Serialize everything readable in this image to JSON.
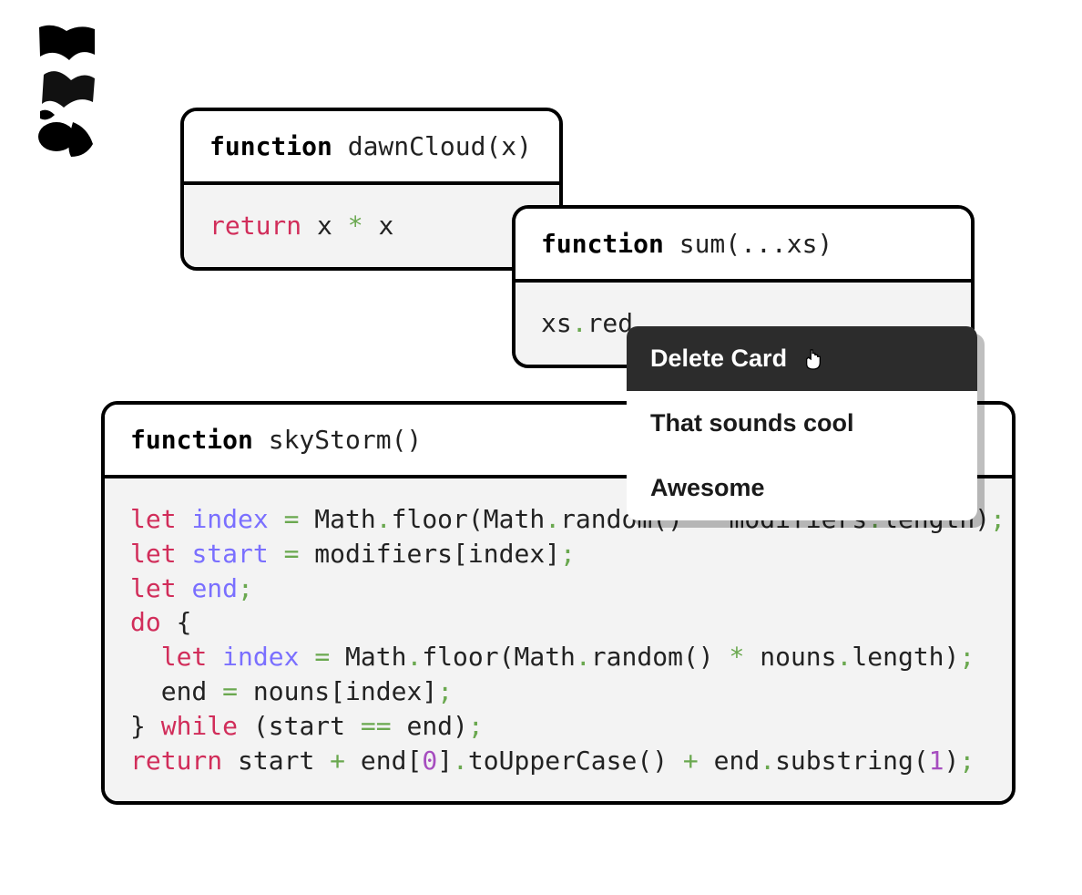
{
  "logo": {
    "kind": "abstract-bw-shape"
  },
  "cards": {
    "dawnCloud": {
      "header": {
        "keyword": "function",
        "rest": " dawnCloud(x)"
      },
      "body_tokens": [
        {
          "t": "return",
          "c": "kw-ret"
        },
        {
          "t": " x ",
          "c": "plain"
        },
        {
          "t": "*",
          "c": "punct"
        },
        {
          "t": " x",
          "c": "plain"
        }
      ]
    },
    "sum": {
      "header": {
        "keyword": "function",
        "rest": " sum(...xs)"
      },
      "body_tokens": [
        {
          "t": "xs",
          "c": "plain"
        },
        {
          "t": ".",
          "c": "punct"
        },
        {
          "t": "red",
          "c": "plain"
        }
      ]
    },
    "skyStorm": {
      "header": {
        "keyword": "function",
        "rest": " skyStorm()"
      },
      "body_lines": [
        [
          {
            "t": "let",
            "c": "kw-let"
          },
          {
            "t": " ",
            "c": "plain"
          },
          {
            "t": "index",
            "c": "ident"
          },
          {
            "t": " ",
            "c": "plain"
          },
          {
            "t": "=",
            "c": "punct"
          },
          {
            "t": " Math",
            "c": "plain"
          },
          {
            "t": ".",
            "c": "punct"
          },
          {
            "t": "floor",
            "c": "plain"
          },
          {
            "t": "(",
            "c": "plain"
          },
          {
            "t": "Math",
            "c": "plain"
          },
          {
            "t": ".",
            "c": "punct"
          },
          {
            "t": "random",
            "c": "plain"
          },
          {
            "t": "()",
            "c": "plain"
          },
          {
            "t": " ",
            "c": "plain"
          },
          {
            "t": "*",
            "c": "punct"
          },
          {
            "t": " modifiers",
            "c": "plain"
          },
          {
            "t": ".",
            "c": "punct"
          },
          {
            "t": "length",
            "c": "plain"
          },
          {
            "t": ")",
            "c": "plain"
          },
          {
            "t": ";",
            "c": "punct"
          }
        ],
        [
          {
            "t": "let",
            "c": "kw-let"
          },
          {
            "t": " ",
            "c": "plain"
          },
          {
            "t": "start",
            "c": "ident"
          },
          {
            "t": " ",
            "c": "plain"
          },
          {
            "t": "=",
            "c": "punct"
          },
          {
            "t": " modifiers",
            "c": "plain"
          },
          {
            "t": "[",
            "c": "plain"
          },
          {
            "t": "index",
            "c": "plain"
          },
          {
            "t": "]",
            "c": "plain"
          },
          {
            "t": ";",
            "c": "punct"
          }
        ],
        [
          {
            "t": "let",
            "c": "kw-let"
          },
          {
            "t": " ",
            "c": "plain"
          },
          {
            "t": "end",
            "c": "ident"
          },
          {
            "t": ";",
            "c": "punct"
          }
        ],
        [
          {
            "t": "do",
            "c": "kw-do"
          },
          {
            "t": " {",
            "c": "plain"
          }
        ],
        [
          {
            "t": "  ",
            "c": "plain"
          },
          {
            "t": "let",
            "c": "kw-let"
          },
          {
            "t": " ",
            "c": "plain"
          },
          {
            "t": "index",
            "c": "ident"
          },
          {
            "t": " ",
            "c": "plain"
          },
          {
            "t": "=",
            "c": "punct"
          },
          {
            "t": " Math",
            "c": "plain"
          },
          {
            "t": ".",
            "c": "punct"
          },
          {
            "t": "floor",
            "c": "plain"
          },
          {
            "t": "(",
            "c": "plain"
          },
          {
            "t": "Math",
            "c": "plain"
          },
          {
            "t": ".",
            "c": "punct"
          },
          {
            "t": "random",
            "c": "plain"
          },
          {
            "t": "()",
            "c": "plain"
          },
          {
            "t": " ",
            "c": "plain"
          },
          {
            "t": "*",
            "c": "punct"
          },
          {
            "t": " nouns",
            "c": "plain"
          },
          {
            "t": ".",
            "c": "punct"
          },
          {
            "t": "length",
            "c": "plain"
          },
          {
            "t": ")",
            "c": "plain"
          },
          {
            "t": ";",
            "c": "punct"
          }
        ],
        [
          {
            "t": "  end ",
            "c": "plain"
          },
          {
            "t": "=",
            "c": "punct"
          },
          {
            "t": " nouns",
            "c": "plain"
          },
          {
            "t": "[",
            "c": "plain"
          },
          {
            "t": "index",
            "c": "plain"
          },
          {
            "t": "]",
            "c": "plain"
          },
          {
            "t": ";",
            "c": "punct"
          }
        ],
        [
          {
            "t": "} ",
            "c": "plain"
          },
          {
            "t": "while",
            "c": "kw-while"
          },
          {
            "t": " (",
            "c": "plain"
          },
          {
            "t": "start ",
            "c": "plain"
          },
          {
            "t": "==",
            "c": "punct"
          },
          {
            "t": " end",
            "c": "plain"
          },
          {
            "t": ")",
            "c": "plain"
          },
          {
            "t": ";",
            "c": "punct"
          }
        ],
        [
          {
            "t": "return",
            "c": "kw-ret"
          },
          {
            "t": " start ",
            "c": "plain"
          },
          {
            "t": "+",
            "c": "punct"
          },
          {
            "t": " end",
            "c": "plain"
          },
          {
            "t": "[",
            "c": "plain"
          },
          {
            "t": "0",
            "c": "num"
          },
          {
            "t": "]",
            "c": "plain"
          },
          {
            "t": ".",
            "c": "punct"
          },
          {
            "t": "toUpperCase",
            "c": "plain"
          },
          {
            "t": "()",
            "c": "plain"
          },
          {
            "t": " ",
            "c": "plain"
          },
          {
            "t": "+",
            "c": "punct"
          },
          {
            "t": " end",
            "c": "plain"
          },
          {
            "t": ".",
            "c": "punct"
          },
          {
            "t": "substring",
            "c": "plain"
          },
          {
            "t": "(",
            "c": "plain"
          },
          {
            "t": "1",
            "c": "num"
          },
          {
            "t": ")",
            "c": "plain"
          },
          {
            "t": ";",
            "c": "punct"
          }
        ]
      ]
    }
  },
  "context_menu": {
    "items": [
      {
        "label": "Delete Card",
        "hover": true,
        "cursor_icon": true
      },
      {
        "label": "That sounds cool",
        "hover": false,
        "cursor_icon": false
      },
      {
        "label": "Awesome",
        "hover": false,
        "cursor_icon": false
      }
    ]
  },
  "colors": {
    "card_border": "#000000",
    "card_body_bg": "#f3f3f3",
    "keyword_red": "#d12d5a",
    "identifier_purple": "#7a6fff",
    "punct_green": "#6aa84f",
    "number_violet": "#a64dbf",
    "menu_hover_bg": "#2c2c2c"
  }
}
